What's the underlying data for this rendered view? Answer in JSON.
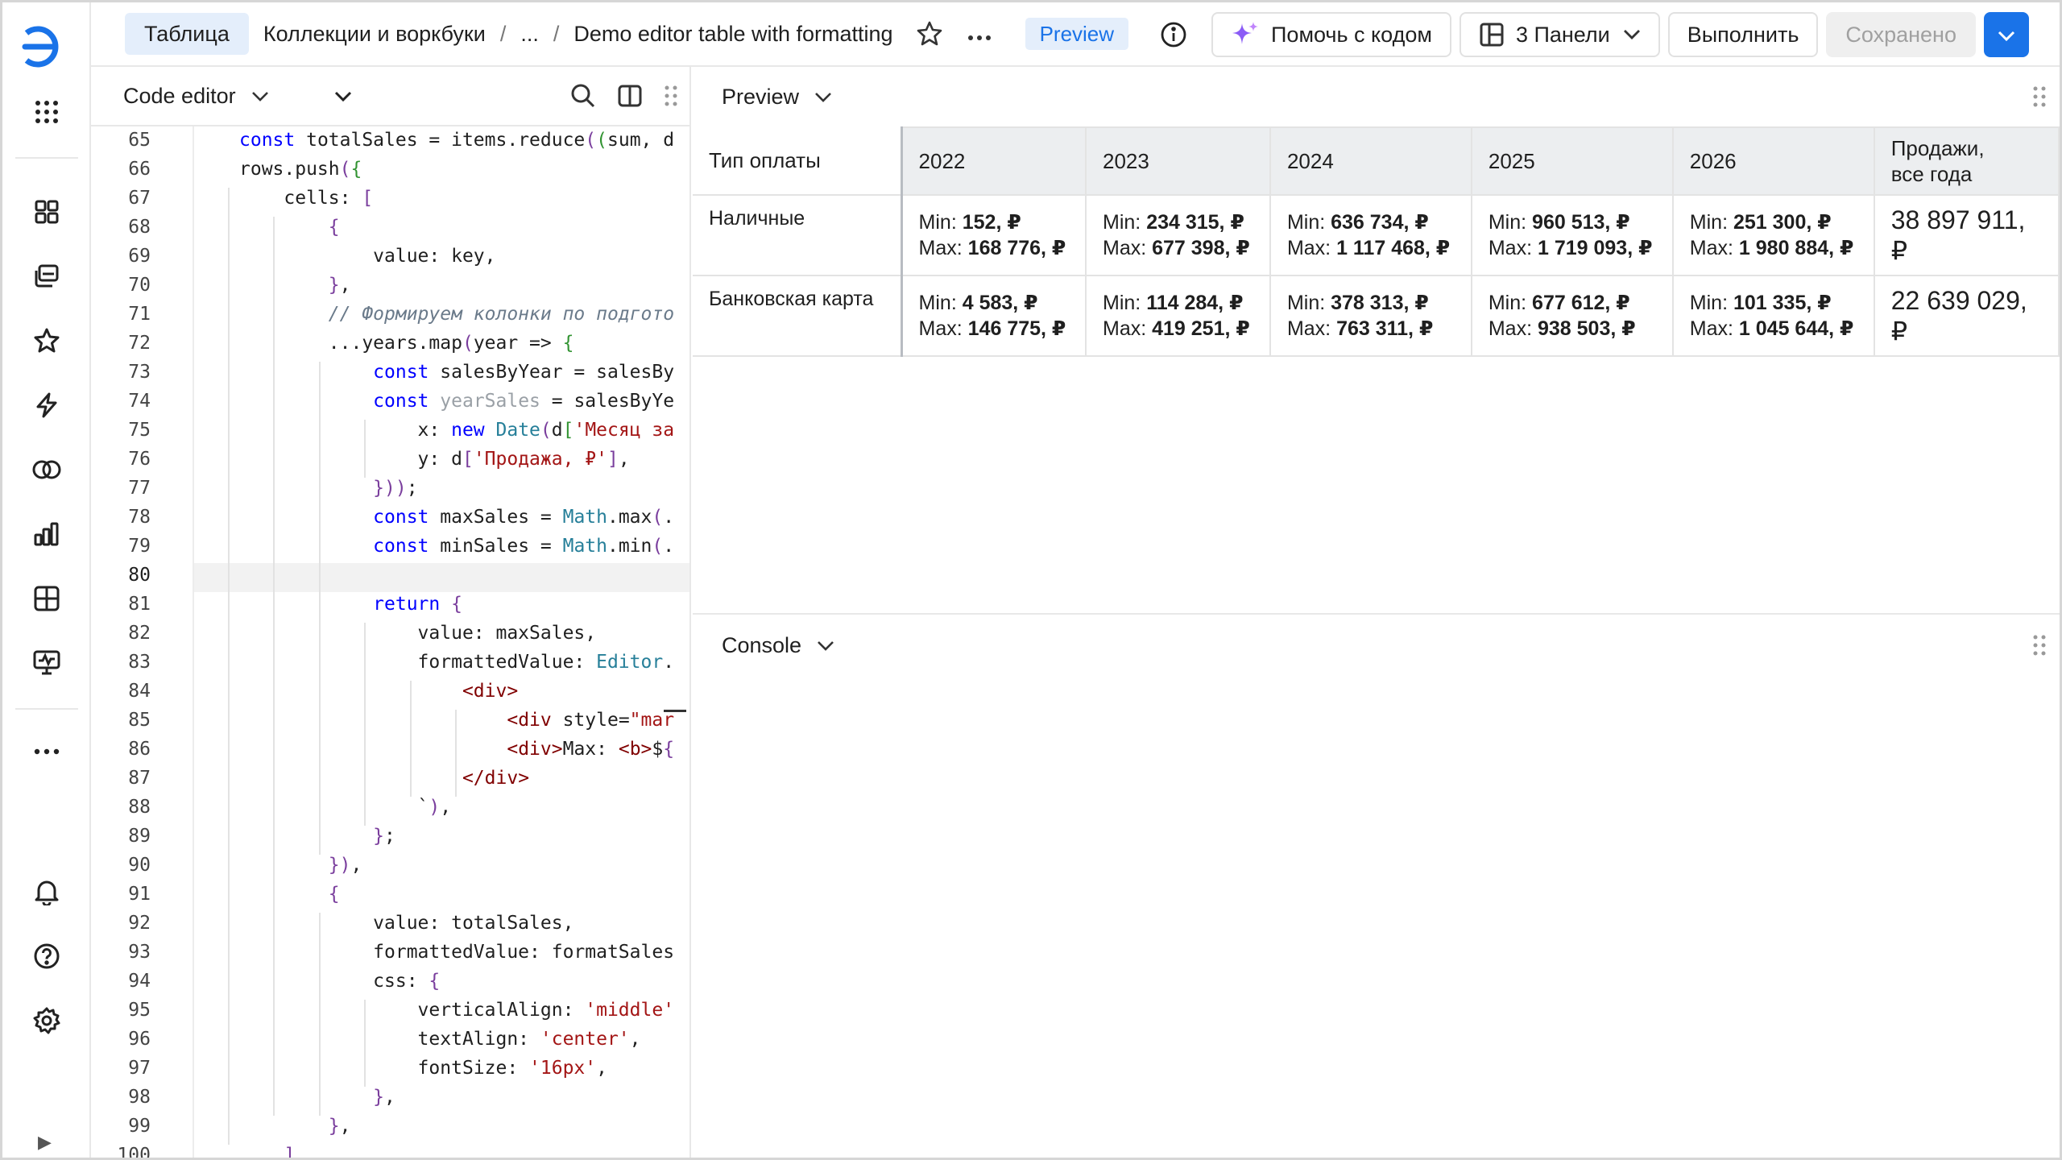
{
  "topbar": {
    "crumbs": [
      "Таблица",
      "Коллекции и воркбуки",
      "...",
      "Demo editor table with formatting"
    ],
    "separator": "/",
    "mode_badge": "Preview",
    "help_button": "Помочь с кодом",
    "panels_button": "3 Панели",
    "run_button": "Выполнить",
    "saved_button": "Сохранено"
  },
  "editor": {
    "title": "Code editor",
    "current_line": 80,
    "lines": [
      {
        "n": 65,
        "code": "const totalSales = items.reduce((sum, d"
      },
      {
        "n": 66,
        "code": "rows.push({"
      },
      {
        "n": 67,
        "code": "    cells: ["
      },
      {
        "n": 68,
        "code": "        {"
      },
      {
        "n": 69,
        "code": "            value: key,"
      },
      {
        "n": 70,
        "code": "        },"
      },
      {
        "n": 71,
        "code": "        // Формируем колонки по подгото"
      },
      {
        "n": 72,
        "code": "        ...years.map(year => {"
      },
      {
        "n": 73,
        "code": "            const salesByYear = salesBy"
      },
      {
        "n": 74,
        "code": "            const yearSales = salesByYe"
      },
      {
        "n": 75,
        "code": "                x: new Date(d['Месяц за"
      },
      {
        "n": 76,
        "code": "                y: d['Продажа, ₽'],"
      },
      {
        "n": 77,
        "code": "            }));"
      },
      {
        "n": 78,
        "code": "            const maxSales = Math.max(."
      },
      {
        "n": 79,
        "code": "            const minSales = Math.min(."
      },
      {
        "n": 80,
        "code": ""
      },
      {
        "n": 81,
        "code": "            return {"
      },
      {
        "n": 82,
        "code": "                value: maxSales,"
      },
      {
        "n": 83,
        "code": "                formattedValue: Editor."
      },
      {
        "n": 84,
        "code": "                    <div>"
      },
      {
        "n": 85,
        "code": "                        <div style=\"mar"
      },
      {
        "n": 86,
        "code": "                        <div>Max: <b>${"
      },
      {
        "n": 87,
        "code": "                    </div>"
      },
      {
        "n": 88,
        "code": "                `),"
      },
      {
        "n": 89,
        "code": "            };"
      },
      {
        "n": 90,
        "code": "        }),"
      },
      {
        "n": 91,
        "code": "        {"
      },
      {
        "n": 92,
        "code": "            value: totalSales,"
      },
      {
        "n": 93,
        "code": "            formattedValue: formatSales"
      },
      {
        "n": 94,
        "code": "            css: {"
      },
      {
        "n": 95,
        "code": "                verticalAlign: 'middle'"
      },
      {
        "n": 96,
        "code": "                textAlign: 'center',"
      },
      {
        "n": 97,
        "code": "                fontSize: '16px',"
      },
      {
        "n": 98,
        "code": "            },"
      },
      {
        "n": 99,
        "code": "        },"
      },
      {
        "n": 100,
        "code": "    ]"
      }
    ]
  },
  "preview": {
    "title": "Preview",
    "table": {
      "headers": [
        "Тип оплаты",
        "2022",
        "2023",
        "2024",
        "2025",
        "2026",
        "Продажи, все года"
      ],
      "total_header_lines": [
        "Продажи,",
        "все года"
      ],
      "rows": [
        {
          "label": "Наличные",
          "cells": [
            {
              "min": "152, ₽",
              "max": "168 776, ₽"
            },
            {
              "min": "234 315, ₽",
              "max": "677 398, ₽"
            },
            {
              "min": "636 734, ₽",
              "max": "1 117 468, ₽"
            },
            {
              "min": "960 513, ₽",
              "max": "1 719 093, ₽"
            },
            {
              "min": "251 300, ₽",
              "max": "1 980 884, ₽"
            }
          ],
          "total": "38 897 911, ₽"
        },
        {
          "label": "Банковская карта",
          "cells": [
            {
              "min": "4 583, ₽",
              "max": "146 775, ₽"
            },
            {
              "min": "114 284, ₽",
              "max": "419 251, ₽"
            },
            {
              "min": "378 313, ₽",
              "max": "763 311, ₽"
            },
            {
              "min": "677 612, ₽",
              "max": "938 503, ₽"
            },
            {
              "min": "101 335, ₽",
              "max": "1 045 644, ₽"
            }
          ],
          "total": "22 639 029, ₽"
        }
      ],
      "min_prefix": "Min:",
      "max_prefix": "Max:"
    }
  },
  "console": {
    "title": "Console"
  },
  "rail": {
    "icons": [
      "logo-icon",
      "apps-grid-icon",
      "dashboards-icon",
      "collections-icon",
      "favorites-icon",
      "flash-icon",
      "datasets-icon",
      "charts-icon",
      "tables-icon",
      "monitoring-icon",
      "more-icon",
      "notifications-icon",
      "help-icon",
      "settings-icon",
      "collapse-icon"
    ]
  },
  "colors": {
    "accent": "#1a73e8",
    "badge_bg": "#e4eefb",
    "header_bg": "#eceef0"
  }
}
